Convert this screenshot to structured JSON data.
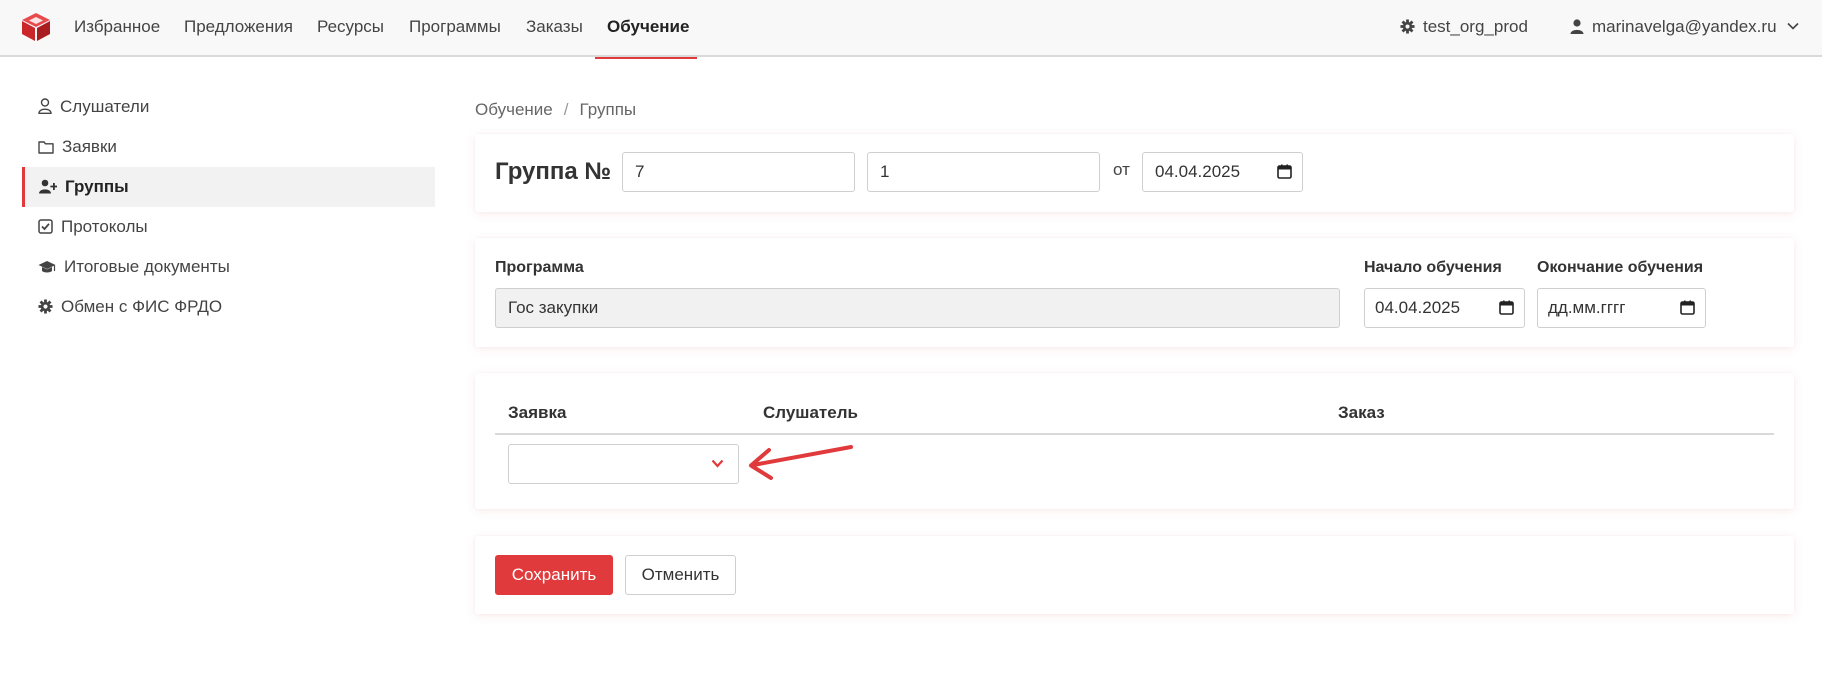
{
  "colors": {
    "accent": "#e03a3c",
    "nav_bg": "#f8f8f8",
    "readonly_bg": "#f1f1f1"
  },
  "nav": {
    "logo_icon": "cube-logo-icon",
    "items": [
      "Избранное",
      "Предложения",
      "Ресурсы",
      "Программы",
      "Заказы",
      "Обучение"
    ],
    "active_index": 5,
    "org": {
      "icon": "gear-icon",
      "label": "test_org_prod"
    },
    "user": {
      "icon": "user-icon",
      "label": "marinavelga@yandex.ru",
      "dropdown_icon": "chevron-down-icon"
    }
  },
  "sidebar": {
    "items": [
      {
        "label": "Слушатели",
        "icon": "user-outline-icon"
      },
      {
        "label": "Заявки",
        "icon": "folder-icon"
      },
      {
        "label": "Группы",
        "icon": "user-plus-icon",
        "active": true
      },
      {
        "label": "Протоколы",
        "icon": "check-square-icon"
      },
      {
        "label": "Итоговые документы",
        "icon": "graduation-cap-icon"
      },
      {
        "label": "Обмен с ФИС ФРДО",
        "icon": "gear-icon"
      }
    ]
  },
  "breadcrumb": {
    "items": [
      "Обучение",
      "Группы"
    ],
    "separator": "/"
  },
  "group": {
    "title": "Группа №",
    "number": "7",
    "suffix": "1",
    "date_prefix": "от",
    "date": "04.04.2025"
  },
  "program": {
    "label": "Программа",
    "value": "Гос закупки",
    "start_label": "Начало обучения",
    "start_value": "04.04.2025",
    "end_label": "Окончание обучения",
    "end_placeholder": "дд.мм.гггг"
  },
  "table": {
    "headers": [
      "Заявка",
      "Слушатель",
      "Заказ"
    ],
    "rows": [
      {
        "application": "",
        "listener": "",
        "order": ""
      }
    ]
  },
  "actions": {
    "save_label": "Сохранить",
    "cancel_label": "Отменить"
  }
}
